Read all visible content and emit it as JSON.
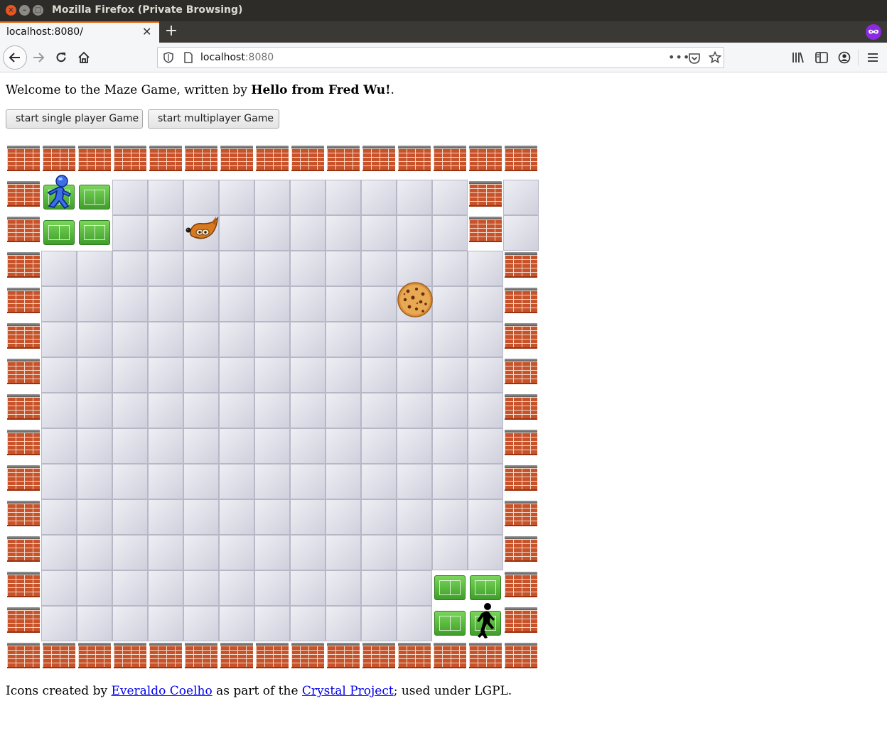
{
  "window": {
    "title": "Mozilla Firefox (Private Browsing)"
  },
  "tab": {
    "title": "localhost:8080/",
    "close_glyph": "✕",
    "newtab_glyph": "+"
  },
  "urlbar": {
    "host": "localhost",
    "port": ":8080",
    "page_actions_glyph": "•••"
  },
  "page": {
    "welcome_prefix": "Welcome to the Maze Game, written by ",
    "welcome_author": "Hello from Fred Wu!",
    "welcome_suffix": ".",
    "single_button": "start single player Game",
    "multi_button": "start multiplayer Game",
    "credits_prefix": "Icons created by ",
    "credits_author": "Everaldo Coelho",
    "credits_middle": " as part of the ",
    "credits_project": "Crystal Project",
    "credits_suffix": "; used under LGPL."
  },
  "maze": {
    "rows": [
      "WWWWWWWWWWWWWWW",
      "WGG..........W.",
      "WGG..........W.",
      "W.............W",
      "W.............W",
      "W.............W",
      "W.............W",
      "W.............W",
      "W.............W",
      "W.............W",
      "W.............W",
      "W.............W",
      "W...........GGW",
      "W...........GGW",
      "WWWWWWWWWWWWWWW"
    ],
    "legend": {
      "W": "brick-wall",
      "G": "green-start-zone",
      ".": "floor-tile"
    },
    "sprites": [
      "running-player-icon",
      "fox-monster-icon",
      "cookie-icon",
      "walking-player-icon"
    ]
  },
  "colors": {
    "titlebar": "#2d2c29",
    "tab_accent": "#e66000",
    "private_purple": "#8a2be2",
    "link": "#0000ee"
  }
}
